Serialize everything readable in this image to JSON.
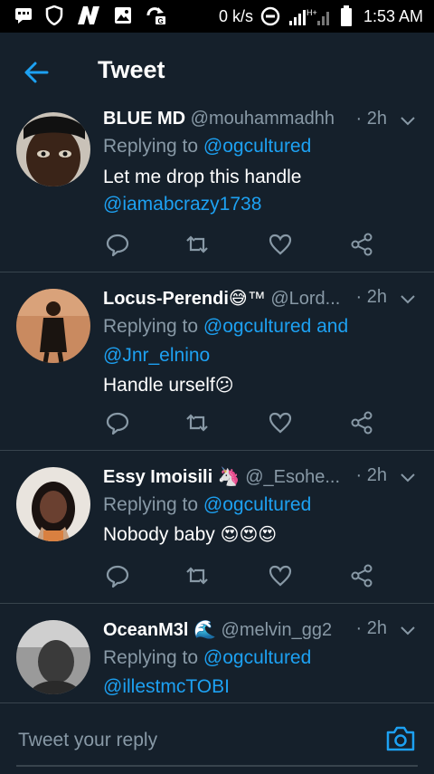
{
  "status_bar": {
    "net_speed": "0 k/s",
    "network_type": "H+",
    "time": "1:53 AM",
    "icons": [
      "message-icon",
      "shield-icon",
      "n-app-icon",
      "gallery-icon",
      "sync-icon",
      "data-saver-icon",
      "signal-icon",
      "battery-icon"
    ]
  },
  "header": {
    "title": "Tweet",
    "back_icon": "arrow-left-icon",
    "accent": "#1da1f2"
  },
  "tweets": [
    {
      "name": "BLUE MD",
      "handle": "@mouhammadhh",
      "time": "· 2h",
      "replying_prefix": "Replying to ",
      "replying_to": "@ogcultured",
      "body_text": "Let me drop this handle",
      "body_link": "@iamabcrazy1738"
    },
    {
      "name": "Locus-Perendi",
      "name_emoji": "😅™",
      "handle": "@Lord...",
      "time": "· 2h",
      "replying_prefix": "Replying to ",
      "replying_to": "@ogcultured and",
      "replying_to_2": "@Jnr_elnino",
      "body_text": "Handle urself",
      "body_emoji": "😕"
    },
    {
      "name": "Essy Imoisili",
      "name_emoji": "🦄",
      "handle": "@_Esohe...",
      "time": "· 2h",
      "replying_prefix": "Replying to ",
      "replying_to": "@ogcultured",
      "body_text": "Nobody baby ",
      "body_emoji": "😍😍😍"
    },
    {
      "name": "OceanM3l",
      "name_emoji": "🌊",
      "handle": "@melvin_gg2",
      "time": "· 2h",
      "replying_prefix": "Replying to ",
      "replying_to": "@ogcultured",
      "body_link": "@illestmcTOBI"
    }
  ],
  "actions": [
    "reply-icon",
    "retweet-icon",
    "like-icon",
    "share-icon"
  ],
  "reply_bar": {
    "placeholder": "Tweet your reply",
    "camera_icon": "camera-icon"
  },
  "colors": {
    "background": "#15202b",
    "link": "#1da1f2",
    "muted": "#8899a6",
    "divider": "#38444d"
  }
}
